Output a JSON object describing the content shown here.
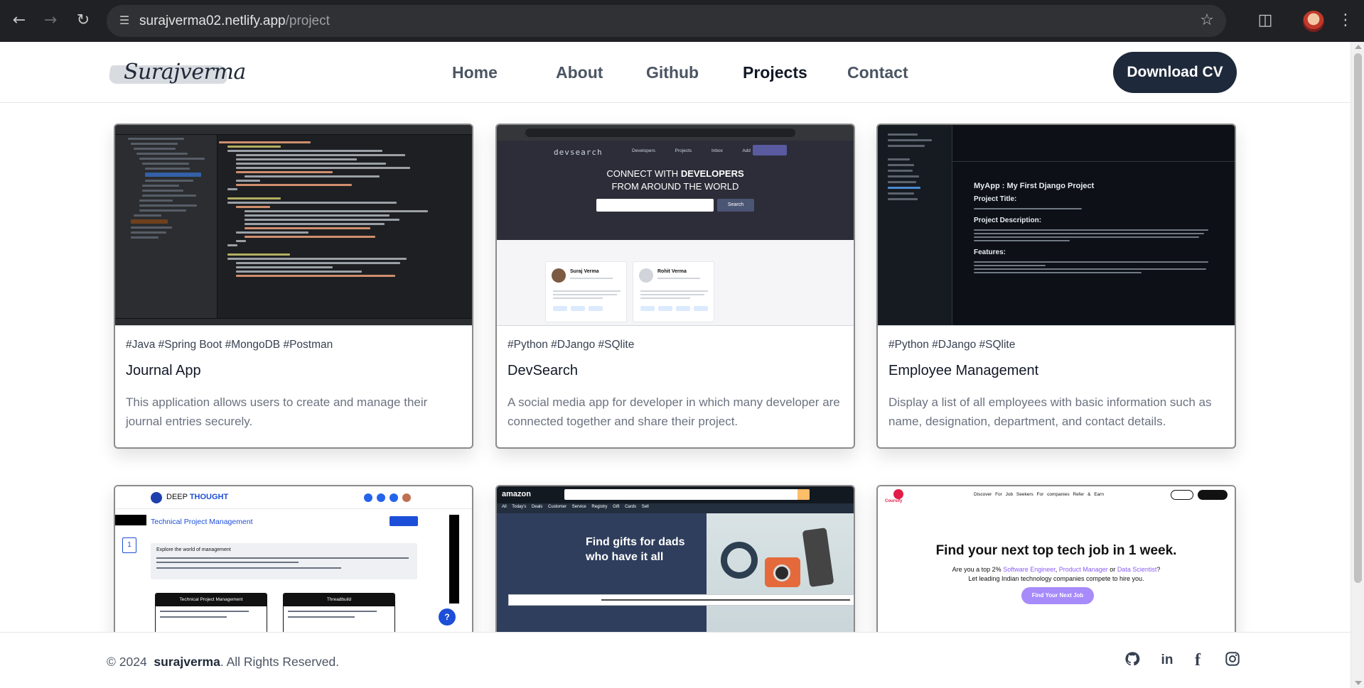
{
  "browser": {
    "url_host": "surajverma02.netlify.app",
    "url_path": "/project",
    "back_icon": "arrow-left-icon",
    "forward_icon": "arrow-right-icon",
    "reload_icon": "reload-icon",
    "site_settings_icon": "tune-icon",
    "bookmark_icon": "star-icon",
    "extensions_icon": "puzzle-icon",
    "menu_icon": "kebab-icon"
  },
  "header": {
    "logo_text": "Surajverma",
    "nav": [
      {
        "label": "Home",
        "active": false
      },
      {
        "label": "About",
        "active": false
      },
      {
        "label": "Github",
        "active": false
      },
      {
        "label": "Projects",
        "active": true
      },
      {
        "label": "Contact",
        "active": false
      }
    ],
    "cta_label": "Download CV",
    "cta_color": "#1e293b"
  },
  "projects": [
    {
      "tags": "#Java #Spring Boot #MongoDB #Postman",
      "title": "Journal App",
      "description": "This application allows users to create and manage their journal entries securely."
    },
    {
      "tags": "#Python #DJango #SQlite",
      "title": "DevSearch",
      "description": "A social media app for developer in which many developer are connected together and share their project.",
      "shot": {
        "brand": "devsearch",
        "links": "Developers Projects Inbox Add Project",
        "headline_pre": "CONNECT WITH",
        "headline_bold": "DEVELOPERS",
        "headline_line2": "FROM AROUND THE WORLD",
        "search_button": "Search",
        "profile_1": "Suraj Verma",
        "profile_2": "Rohit Verma"
      }
    },
    {
      "tags": "#Python #DJango #SQlite",
      "title": "Employee Management",
      "description": "Display a list of all employees with basic information such as name, designation, department, and contact details.",
      "shot": {
        "readme_title": "MyApp : My First Django Project",
        "heading_1": "Project Title:",
        "heading_2": "Project Description:",
        "heading_3": "Features:"
      }
    },
    {
      "shot": {
        "brand_pre": "DEEP",
        "brand_bold": "THOUGHT",
        "page_title": "Technical Project Management",
        "step": "1",
        "box_title": "Explore the world of management",
        "card_1": "Technical Project Management",
        "card_2": "Threadbuild",
        "help": "?"
      }
    },
    {
      "shot": {
        "logo": "amazon",
        "subnav": "All Today's Deals Customer Service Registry Gift Cards Sell",
        "banner_text": "Find gifts for dads who have it all"
      }
    },
    {
      "shot": {
        "logo": "Coursify",
        "nav": "Discover For Job Seekers For companies Refer & Earn",
        "headline": "Find your next top tech job in 1 week.",
        "sub_pre": "Are you a top 2%",
        "sub_role_1": "Software Engineer",
        "sub_role_2": "Product Manager",
        "sub_role_3": "Data Scientist",
        "sub_line2": "Let leading Indian technology companies compete to hire you.",
        "cta": "Find Your Next Job"
      }
    }
  ],
  "footer": {
    "copyright_prefix": "© 2024",
    "owner": "surajverma",
    "rights": ". All Rights Reserved.",
    "social_icons": [
      "github-icon",
      "linkedin-icon",
      "facebook-icon",
      "instagram-icon"
    ]
  }
}
